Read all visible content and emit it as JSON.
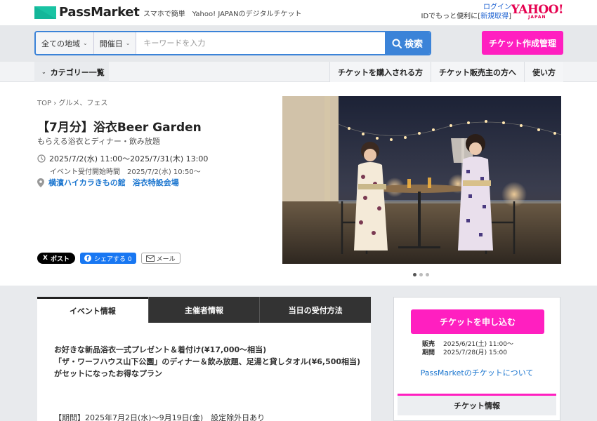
{
  "header": {
    "brand": "PassMarket",
    "tagline": "スマホで簡単　Yahoo! JAPANのデジタルチケット",
    "login": "ログイン",
    "id_note": "IDでもっと便利に",
    "bracket_open": "[",
    "register": "新規取得",
    "bracket_close": "]",
    "yahoo": "YAHOO!",
    "yahoo_sub": "JAPAN"
  },
  "search": {
    "region": "全ての地域",
    "date": "開催日",
    "placeholder": "キーワードを入力",
    "button": "検索"
  },
  "create_button": "チケット作成管理",
  "nav": {
    "category": "カテゴリー一覧",
    "links": [
      "チケットを購入される方",
      "チケット販売主の方へ",
      "使い方"
    ]
  },
  "event": {
    "breadcrumb": "TOP › グルメ、フェス",
    "title": "【7月分】浴衣Beer Garden",
    "subtitle": "もらえる浴衣とディナー・飲み放題",
    "datetime": "2025/7/2(水) 11:00〜2025/7/31(木) 13:00",
    "accept": "イベント受付開始時間　2025/7/2(水) 10:50〜",
    "venue1": "横濱ハイカラきもの館",
    "venue2": "浴衣特設会場"
  },
  "share": {
    "x": "ポスト",
    "x_mark": "X",
    "fb": "シェアする 0",
    "fb_mark": "f",
    "mail": "メール"
  },
  "tabs": [
    "イベント情報",
    "主催者情報",
    "当日の受付方法"
  ],
  "description": {
    "l1": "お好きな新品浴衣一式プレゼント＆着付け(¥17,000〜相当)",
    "l2": "「ザ・ワーフハウス山下公園」のディナー＆飲み放題、足湯と貸しタオル(¥6,500相当)",
    "l3": "がセットになったお得なプラン",
    "period": "【期間】2025年7月2日(水)〜9月19日(金)　設定除外日あり"
  },
  "sidebar": {
    "apply": "チケットを申し込む",
    "sale_label1": "販売",
    "sale_label2": "期間",
    "sale_from": "2025/6/21(土) 11:00〜",
    "sale_to": "2025/7/28(月) 15:00",
    "about": "PassMarketのチケットについて",
    "ticket_info": "チケット情報"
  },
  "colors": {
    "accent_pink": "#ff1fc0",
    "accent_blue": "#3b83d8",
    "brand_green": "#19c3a3",
    "yahoo_red": "#e5004f"
  },
  "carousel": {
    "slides": 3,
    "active": 1
  }
}
